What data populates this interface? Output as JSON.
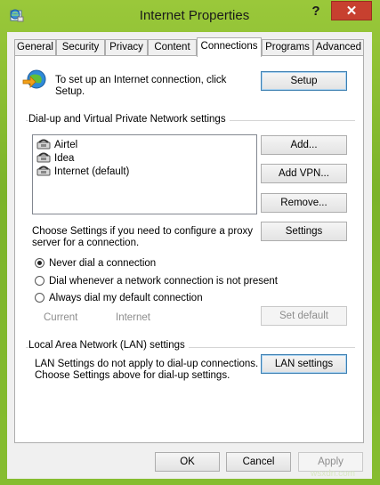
{
  "window": {
    "title": "Internet Properties",
    "help_label": "?",
    "close_label": "✕"
  },
  "tabs": [
    {
      "label": "General"
    },
    {
      "label": "Security"
    },
    {
      "label": "Privacy"
    },
    {
      "label": "Content"
    },
    {
      "label": "Connections",
      "active": true
    },
    {
      "label": "Programs"
    },
    {
      "label": "Advanced"
    }
  ],
  "connections": {
    "setup_text_line1": "To set up an Internet connection, click",
    "setup_text_line2": "Setup.",
    "setup_button": "Setup",
    "dialup_heading": "Dial-up and Virtual Private Network settings",
    "connection_list": [
      {
        "name": "Airtel"
      },
      {
        "name": "Idea"
      },
      {
        "name": "Internet (default)"
      }
    ],
    "add_button": "Add...",
    "add_vpn_button": "Add VPN...",
    "remove_button": "Remove...",
    "proxy_text_line1": "Choose Settings if you need to configure a proxy",
    "proxy_text_line2": "server for a connection.",
    "settings_button": "Settings",
    "radio_options": [
      {
        "label": "Never dial a connection",
        "selected": true
      },
      {
        "label": "Dial whenever a network connection is not present",
        "selected": false
      },
      {
        "label": "Always dial my default connection",
        "selected": false
      }
    ],
    "current_label": "Current",
    "current_value": "Internet",
    "set_default_button": "Set default",
    "lan_heading": "Local Area Network (LAN) settings",
    "lan_text_line1": "LAN Settings do not apply to dial-up connections.",
    "lan_text_line2": "Choose Settings above for dial-up settings.",
    "lan_settings_button": "LAN settings"
  },
  "footer": {
    "ok_button": "OK",
    "cancel_button": "Cancel",
    "apply_button": "Apply"
  },
  "watermark": "wsxdn.com",
  "colors": {
    "window_frame": "#86bd30",
    "close_button": "#c7402f",
    "dialog_bg": "#f0f0f0",
    "focus_border": "#3c7fb1"
  },
  "icons": {
    "app": "internet-globe-icon",
    "setup": "globe-with-arrow-icon",
    "connection": "phone-modem-icon",
    "pointer": "black-up-arrow-icon"
  }
}
